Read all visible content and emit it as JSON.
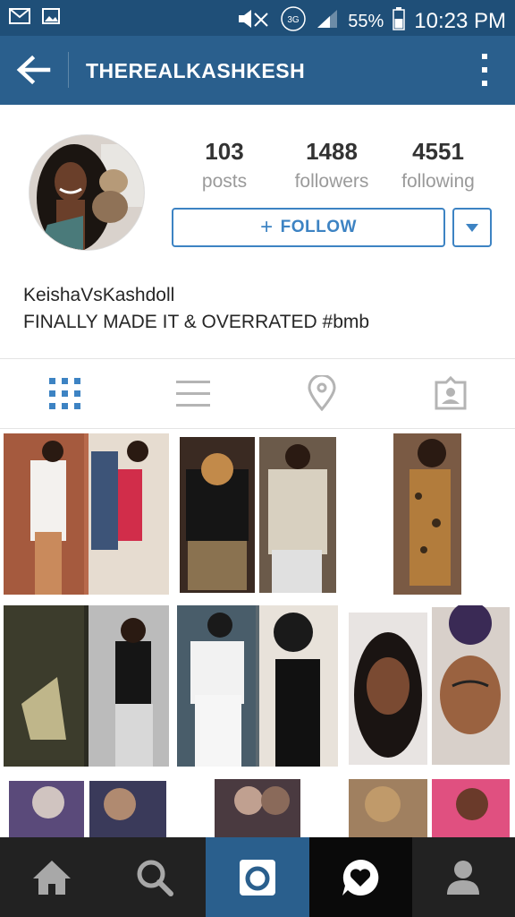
{
  "status_bar": {
    "network": "3G",
    "battery": "55%",
    "time": "10:23 PM",
    "icons": [
      "email-icon",
      "gallery-notification-icon",
      "mute-icon",
      "network-3g-icon",
      "signal-icon",
      "battery-icon"
    ]
  },
  "header": {
    "title": "THEREALKASHKESH",
    "back_icon": "arrow-left-icon",
    "menu_icon": "more-vert-icon"
  },
  "profile": {
    "stats": [
      {
        "value": "103",
        "label": "posts"
      },
      {
        "value": "1488",
        "label": "followers"
      },
      {
        "value": "4551",
        "label": "following"
      }
    ],
    "follow_label": "FOLLOW",
    "follow_plus": "+",
    "full_name": "KeishaVsKashdoll",
    "bio": "FINALLY MADE IT & OVERRATED #bmb"
  },
  "tabs": [
    {
      "name": "grid-view",
      "icon": "grid-icon",
      "active": true
    },
    {
      "name": "list-view",
      "icon": "list-icon",
      "active": false
    },
    {
      "name": "photo-map",
      "icon": "location-pin-icon",
      "active": false
    },
    {
      "name": "tagged",
      "icon": "tagged-person-icon",
      "active": false
    }
  ],
  "bottom_nav": [
    {
      "name": "home",
      "icon": "home-icon"
    },
    {
      "name": "search",
      "icon": "search-icon"
    },
    {
      "name": "camera",
      "icon": "camera-icon"
    },
    {
      "name": "activity",
      "icon": "heart-bubble-icon"
    },
    {
      "name": "profile",
      "icon": "person-icon"
    }
  ],
  "colors": {
    "status_bar": "#1f4f78",
    "header": "#2a5f8d",
    "accent": "#3d83c3",
    "nav_bg": "#222222"
  }
}
